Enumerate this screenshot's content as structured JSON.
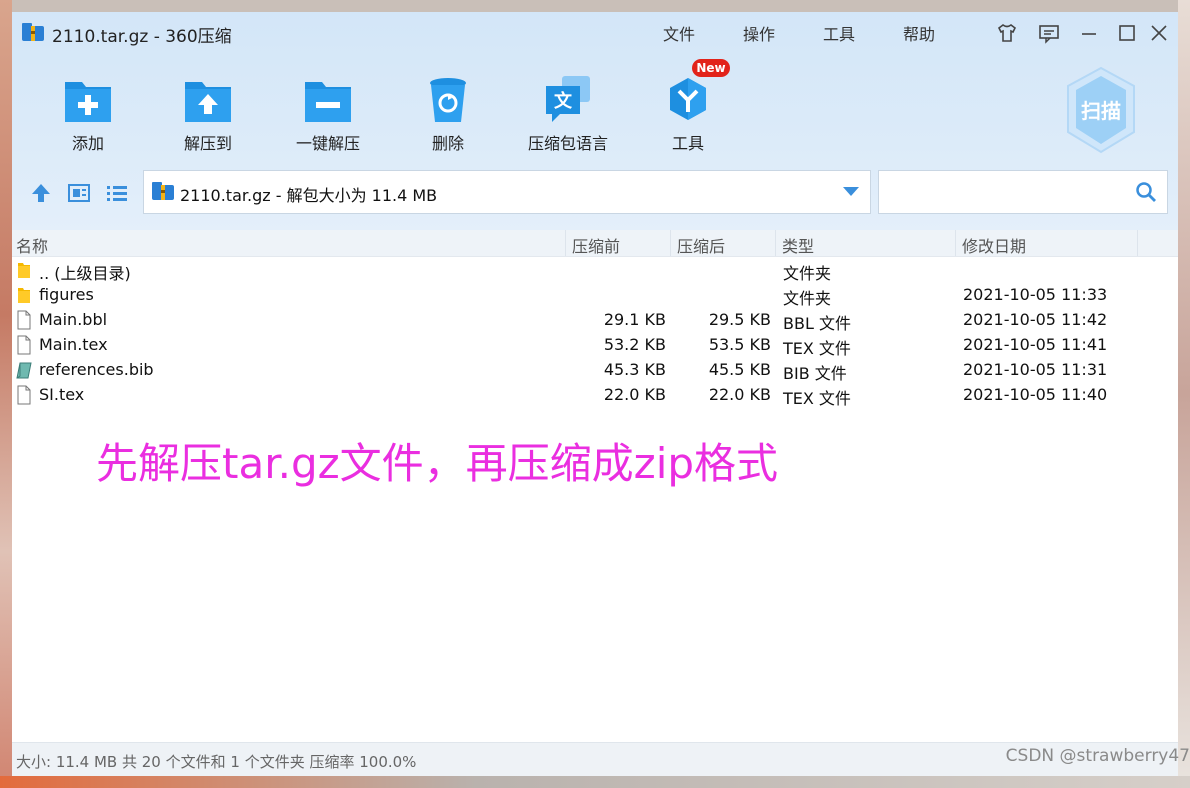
{
  "window": {
    "title": "2110.tar.gz - 360压缩"
  },
  "menu": {
    "file": "文件",
    "operate": "操作",
    "tools": "工具",
    "help": "帮助"
  },
  "toolbar": {
    "add": "添加",
    "extract_to": "解压到",
    "one_click_extract": "一键解压",
    "delete": "删除",
    "archive_language": "压缩包语言",
    "tools": "工具",
    "new_badge": "New",
    "scan": "扫描"
  },
  "address": {
    "path": "2110.tar.gz - 解包大小为 11.4 MB",
    "search_placeholder": ""
  },
  "columns": {
    "name": "名称",
    "compressed": "压缩前",
    "uncompressed": "压缩后",
    "type": "类型",
    "modified": "修改日期"
  },
  "files": [
    {
      "name": ".. (上级目录)",
      "csize": "",
      "usize": "",
      "type": "文件夹",
      "date": "",
      "icon": "folder-icon"
    },
    {
      "name": "figures",
      "csize": "",
      "usize": "",
      "type": "文件夹",
      "date": "2021-10-05 11:33",
      "icon": "folder-icon"
    },
    {
      "name": "Main.bbl",
      "csize": "29.1 KB",
      "usize": "29.5 KB",
      "type": "BBL 文件",
      "date": "2021-10-05 11:42",
      "icon": "file-icon"
    },
    {
      "name": "Main.tex",
      "csize": "53.2 KB",
      "usize": "53.5 KB",
      "type": "TEX 文件",
      "date": "2021-10-05 11:41",
      "icon": "file-icon"
    },
    {
      "name": "references.bib",
      "csize": "45.3 KB",
      "usize": "45.5 KB",
      "type": "BIB 文件",
      "date": "2021-10-05 11:31",
      "icon": "bib-file-icon"
    },
    {
      "name": "SI.tex",
      "csize": "22.0 KB",
      "usize": "22.0 KB",
      "type": "TEX 文件",
      "date": "2021-10-05 11:40",
      "icon": "file-icon"
    }
  ],
  "annotation": "先解压tar.gz文件，再压缩成zip格式",
  "status": "大小: 11.4 MB 共 20 个文件和 1 个文件夹 压缩率 100.0%",
  "watermark": "CSDN @strawberry47",
  "colors": {
    "accent": "#1e8fe0",
    "annotation": "#ea2ee0",
    "folder": "#f5b800"
  }
}
